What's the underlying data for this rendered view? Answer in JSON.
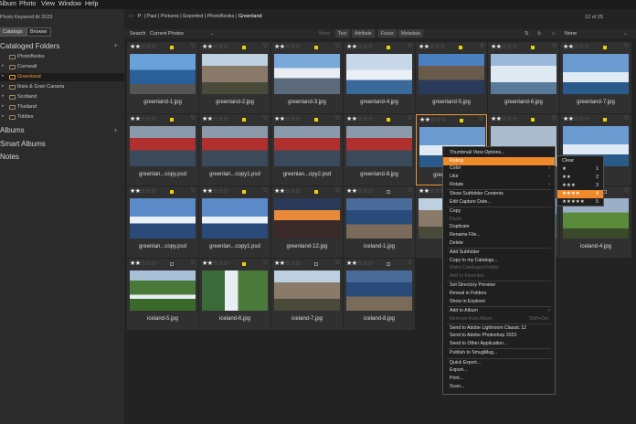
{
  "menubar": [
    "Album",
    "Photo",
    "View",
    "Window",
    "Help"
  ],
  "app_title": "Photo Keyword AI 2023",
  "left_tabs": [
    "Catalogs",
    "Browse"
  ],
  "sections": {
    "cataloged": "Cataloged Folders",
    "albums": "Albums",
    "smart": "Smart Albums",
    "notes": "Notes"
  },
  "folders": [
    {
      "label": "PhotoBooks",
      "selected": false,
      "arrow": ""
    },
    {
      "label": "Cornwall",
      "selected": false,
      "arrow": "▸"
    },
    {
      "label": "Greenland",
      "selected": true,
      "arrow": "▸"
    },
    {
      "label": "Ibiza & Gran Canaria",
      "selected": false,
      "arrow": "▸"
    },
    {
      "label": "Scotland",
      "selected": false,
      "arrow": "▸"
    },
    {
      "label": "Thailand",
      "selected": false,
      "arrow": "▸"
    },
    {
      "label": "Tiddles",
      "selected": false,
      "arrow": "▸"
    }
  ],
  "breadcrumb": {
    "nav": "‹ ›",
    "path": "P: | Paul | Pictures | Exported | PhotoBooks | ",
    "current": "Greenland"
  },
  "pager": "12 of 25",
  "toolbar": {
    "search_label": "Search",
    "search_scope": "Current Photos",
    "filters": [
      "None",
      "Text",
      "Attribute",
      "Faces",
      "Metadata"
    ],
    "sort_value": "None"
  },
  "photos": [
    {
      "name": "greenland-1.jpg",
      "rating": 2,
      "flag": true,
      "theme": "building"
    },
    {
      "name": "greenland-2.jpg",
      "rating": 2,
      "flag": true,
      "theme": "rocks"
    },
    {
      "name": "greenland-3.jpg",
      "rating": 2,
      "flag": true,
      "theme": "mountain"
    },
    {
      "name": "greenland-4.jpg",
      "rating": 2,
      "flag": true,
      "theme": "boat"
    },
    {
      "name": "greenland-5.jpg",
      "rating": 2,
      "flag": true,
      "theme": "fjord"
    },
    {
      "name": "greenland-6.jpg",
      "rating": 2,
      "flag": true,
      "theme": "glacier"
    },
    {
      "name": "greenland-7.jpg",
      "rating": 2,
      "flag": true,
      "theme": "ice"
    },
    {
      "name": "greenlan...copy.psd",
      "rating": 2,
      "flag": true,
      "theme": "kayak"
    },
    {
      "name": "greenlan...copy1.psd",
      "rating": 2,
      "flag": true,
      "theme": "kayak"
    },
    {
      "name": "greenlan...opy2.psd",
      "rating": 2,
      "flag": true,
      "theme": "kayak"
    },
    {
      "name": "greenland-8.jpg",
      "rating": 2,
      "flag": true,
      "theme": "kayak"
    },
    {
      "name": "greenland-9.jpg",
      "rating": 2,
      "flag": true,
      "theme": "ice"
    },
    {
      "name": "",
      "rating": 2,
      "flag": true,
      "theme": "snow"
    },
    {
      "name": "",
      "rating": 2,
      "flag": true,
      "theme": "ice"
    },
    {
      "name": "greenlan...copy.psd",
      "rating": 2,
      "flag": true,
      "theme": "iceberg"
    },
    {
      "name": "greenlan...copy1.psd",
      "rating": 2,
      "flag": true,
      "theme": "iceberg"
    },
    {
      "name": "greenland-12.jpg",
      "rating": 2,
      "flag": true,
      "theme": "sunset"
    },
    {
      "name": "iceland-1.jpg",
      "rating": 2,
      "flag": false,
      "theme": "lake"
    },
    {
      "name": "",
      "rating": 2,
      "flag": false,
      "theme": "rocks"
    },
    {
      "name": "",
      "rating": 2,
      "flag": false,
      "theme": "coast"
    },
    {
      "name": "iceland-4.jpg",
      "rating": 2,
      "flag": false,
      "theme": "green"
    },
    {
      "name": "iceland-5.jpg",
      "rating": 2,
      "flag": false,
      "theme": "waterfall"
    },
    {
      "name": "iceland-6.jpg",
      "rating": 2,
      "flag": true,
      "theme": "waterfall2"
    },
    {
      "name": "iceland-7.jpg",
      "rating": 2,
      "flag": false,
      "theme": "rocks"
    },
    {
      "name": "iceland-8.jpg",
      "rating": 2,
      "flag": false,
      "theme": "lake"
    }
  ],
  "context_menu": [
    {
      "label": "Thumbnail View Options...",
      "type": "item"
    },
    {
      "label": "Rating",
      "type": "sub",
      "hl": true
    },
    {
      "label": "Color",
      "type": "sub"
    },
    {
      "label": "Like",
      "type": "sub"
    },
    {
      "label": "Rotate",
      "type": "sub"
    },
    {
      "label": "Show Subfolder Contents",
      "type": "item"
    },
    {
      "label": "Edit Capture Date...",
      "type": "item"
    },
    {
      "label": "Copy",
      "type": "item"
    },
    {
      "label": "Paste",
      "type": "dis"
    },
    {
      "label": "Duplicate",
      "type": "item"
    },
    {
      "label": "Rename File...",
      "type": "item"
    },
    {
      "label": "Delete",
      "type": "item"
    },
    {
      "label": "Add Subfolder",
      "type": "item"
    },
    {
      "label": "Copy to my Catalogs...",
      "type": "item"
    },
    {
      "label": "Make Cataloged Folder",
      "type": "dis"
    },
    {
      "label": "Add to Favorites",
      "type": "dis"
    },
    {
      "label": "Set Directory Preview",
      "type": "item"
    },
    {
      "label": "Reveal in Folders",
      "type": "item"
    },
    {
      "label": "Show in Explorer",
      "type": "item"
    },
    {
      "label": "Add to Album",
      "type": "sub"
    },
    {
      "label": "Remove from Album",
      "type": "dis",
      "shortcut": "Shift+Del"
    },
    {
      "label": "Send to Adobe Lightroom Classic 12",
      "type": "item"
    },
    {
      "label": "Send to Adobe Photoshop 2023",
      "type": "item"
    },
    {
      "label": "Send to Other Application...",
      "type": "item"
    },
    {
      "label": "Publish to SmugMug...",
      "type": "item"
    },
    {
      "label": "Quick Export...",
      "type": "item"
    },
    {
      "label": "Export...",
      "type": "item"
    },
    {
      "label": "Print...",
      "type": "item"
    },
    {
      "label": "Scan...",
      "type": "item"
    }
  ],
  "rating_submenu": [
    {
      "label": "Clear",
      "key": ""
    },
    {
      "label": "★",
      "key": "1"
    },
    {
      "label": "★★",
      "key": "2"
    },
    {
      "label": "★★★",
      "key": "3"
    },
    {
      "label": "★★★★",
      "key": "4",
      "hl": true
    },
    {
      "label": "★★★★★",
      "key": "5"
    }
  ],
  "colors": {
    "accent": "#ef8a2a",
    "flag": "#e8d600",
    "selected_border": "#f09a3a"
  }
}
